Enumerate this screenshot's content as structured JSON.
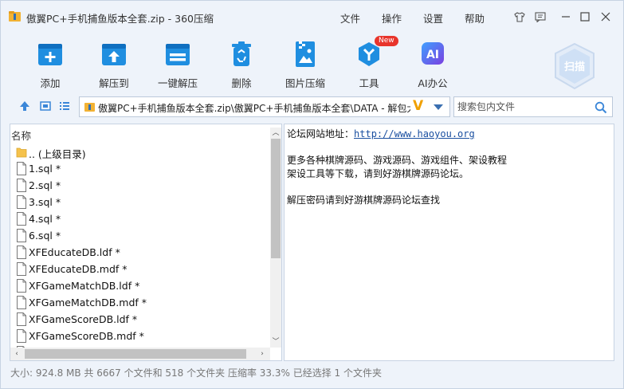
{
  "window": {
    "title": "傲翼PC+手机捕鱼版本全套.zip - 360压缩",
    "menu": [
      "文件",
      "操作",
      "设置",
      "帮助"
    ]
  },
  "toolbar": {
    "tools": [
      {
        "label": "添加",
        "icon": "add-archive-icon"
      },
      {
        "label": "解压到",
        "icon": "extract-to-icon"
      },
      {
        "label": "一键解压",
        "icon": "one-click-extract-icon"
      },
      {
        "label": "删除",
        "icon": "trash-icon"
      },
      {
        "label": "图片压缩",
        "icon": "image-compress-icon"
      },
      {
        "label": "工具",
        "icon": "tools-icon",
        "badge": "New"
      },
      {
        "label": "AI办公",
        "icon": "ai-office-icon",
        "glyph": "AI"
      }
    ],
    "scan_label": "扫描"
  },
  "address": {
    "path": "傲翼PC+手机捕鱼版本全套.zip\\傲翼PC+手机捕鱼版本全套\\DATA - 解包大小",
    "badge": "V",
    "search_placeholder": "搜索包内文件"
  },
  "filelist": {
    "column_header": "名称",
    "items": [
      {
        "name": ".. (上级目录)",
        "type": "folder"
      },
      {
        "name": "1.sql *",
        "type": "file"
      },
      {
        "name": "2.sql *",
        "type": "file"
      },
      {
        "name": "3.sql *",
        "type": "file"
      },
      {
        "name": "4.sql *",
        "type": "file"
      },
      {
        "name": "6.sql *",
        "type": "file"
      },
      {
        "name": "XFEducateDB.ldf *",
        "type": "file"
      },
      {
        "name": "XFEducateDB.mdf *",
        "type": "file"
      },
      {
        "name": "XFGameMatchDB.ldf *",
        "type": "file"
      },
      {
        "name": "XFGameMatchDB.mdf *",
        "type": "file"
      },
      {
        "name": "XFGameScoreDB.ldf *",
        "type": "file"
      },
      {
        "name": "XFGameScoreDB.mdf *",
        "type": "file"
      },
      {
        "name": "",
        "type": "file"
      }
    ]
  },
  "comment": {
    "forum_label": "论坛网站地址：",
    "forum_url": "http://www.haoyou.org",
    "line2": "更多各种棋牌源码、游戏源码、游戏组件、架设教程",
    "line3": "架设工具等下载，请到好游棋牌源码论坛。",
    "line4": "解压密码请到好游棋牌源码论坛查找"
  },
  "status": {
    "text": "大小: 924.8 MB 共 6667 个文件和 518 个文件夹 压缩率 33.3% 已经选择 1 个文件夹"
  },
  "colors": {
    "accent_blue": "#1f8ee0",
    "window_bg": "#eef3fa",
    "badge_red": "#e8342b",
    "ai_purple": "#5a4fd6"
  }
}
